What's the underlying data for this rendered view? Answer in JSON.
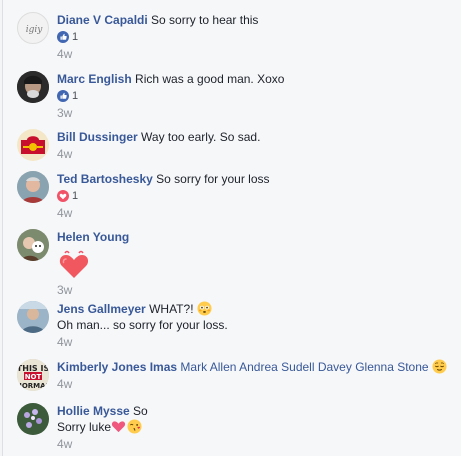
{
  "comments": [
    {
      "name": "Diane V Capaldi",
      "text": "So sorry to hear this",
      "reaction_type": "like",
      "reaction_count": "1",
      "time": "4w"
    },
    {
      "name": "Marc English",
      "text": "Rich was a good man. Xoxo",
      "reaction_type": "like",
      "reaction_count": "1",
      "time": "3w"
    },
    {
      "name": "Bill Dussinger",
      "text": "Way too early. So sad.",
      "time": "4w"
    },
    {
      "name": "Ted Bartoshesky",
      "text": "So sorry for your loss",
      "reaction_type": "love",
      "reaction_count": "1",
      "time": "4w"
    },
    {
      "name": "Helen Young",
      "sticker": "beating-heart-icon",
      "time": "3w"
    },
    {
      "name": "Jens Gallmeyer",
      "text": "WHAT?!",
      "text_emoji": "flushed-face-icon",
      "text2": "Oh man... so sorry for your loss.",
      "time": "4w"
    },
    {
      "name": "Kimberly Jones Imas",
      "tags": [
        "Mark Allen",
        "Andrea Sudell Davey",
        "Glenna Stone"
      ],
      "text_emoji": "relieved-face-icon",
      "time": "4w"
    },
    {
      "name": "Hollie Mysse",
      "text": "So",
      "text2": "Sorry luke",
      "text2_emojis": [
        "heart-icon",
        "kissing-face-icon"
      ],
      "time": "4w"
    }
  ],
  "colors": {
    "name_link": "#385898",
    "meta": "#90949c",
    "like": "#4267b2",
    "love": "#f25268"
  }
}
